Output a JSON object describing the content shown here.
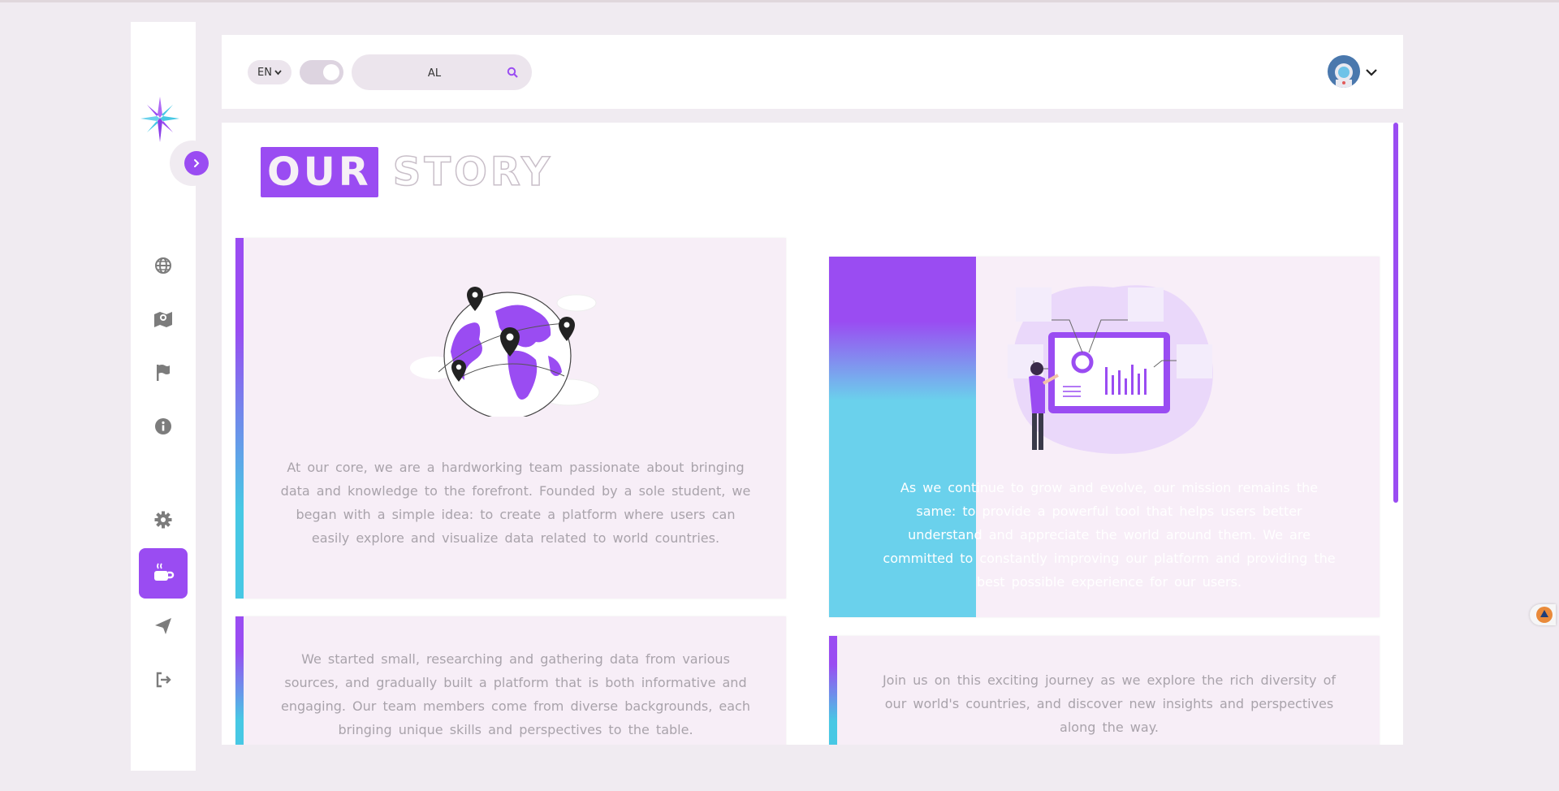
{
  "header": {
    "language": "EN",
    "search": {
      "value": "AL"
    }
  },
  "page": {
    "title_highlight": "OUR",
    "title_rest": "STORY"
  },
  "cards": [
    {
      "text": "At our core, we are a hardworking team passionate about bringing data and knowledge to the forefront. Founded by a sole student, we began with a simple idea: to create a platform where users can easily explore and visualize data related to world countries."
    },
    {
      "text": "We started small, researching and gathering data from various sources, and gradually built a platform that is both informative and engaging. Our team members come from diverse backgrounds, each bringing unique skills and perspectives to the table."
    },
    {
      "text": "As we continue to grow and evolve, our mission remains the same: to provide a powerful tool that helps users better understand and appreciate the world around them. We are committed to constantly improving our platform and providing the best possible experience for our users."
    },
    {
      "text": "Join us on this exciting journey as we explore the rich diversity of our world's countries, and discover new insights and perspectives along the way."
    }
  ],
  "sidebar": {
    "items": [
      {
        "icon": "globe-icon"
      },
      {
        "icon": "map-icon"
      },
      {
        "icon": "flag-icon"
      },
      {
        "icon": "info-icon"
      },
      {
        "icon": "gear-icon"
      },
      {
        "icon": "coffee-icon",
        "active": true
      },
      {
        "icon": "paper-plane-icon"
      },
      {
        "icon": "logout-icon"
      }
    ]
  },
  "colors": {
    "accent": "#9a4cf2",
    "accent2": "#47c8e4",
    "background": "#f0ebf1"
  }
}
